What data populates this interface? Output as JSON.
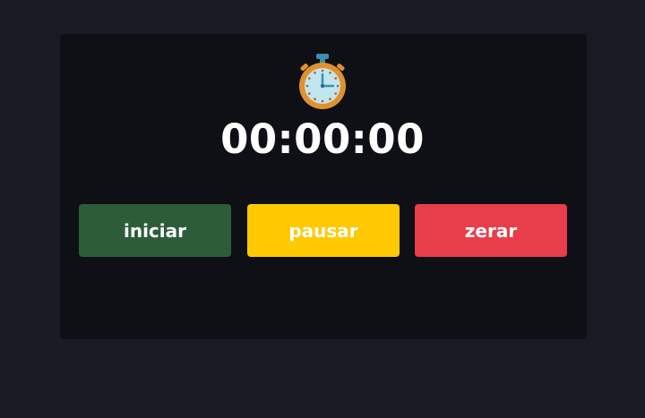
{
  "timer": {
    "display": "00:00:00",
    "icon": "stopwatch-icon"
  },
  "buttons": {
    "start": {
      "label": "iniciar",
      "color": "#2d5c39"
    },
    "pause": {
      "label": "pausar",
      "color": "#ffc900"
    },
    "reset": {
      "label": "zerar",
      "color": "#e83d4b"
    }
  },
  "colors": {
    "page_background": "#181b22",
    "card_background": "#0e1016",
    "text": "#ffffff"
  }
}
